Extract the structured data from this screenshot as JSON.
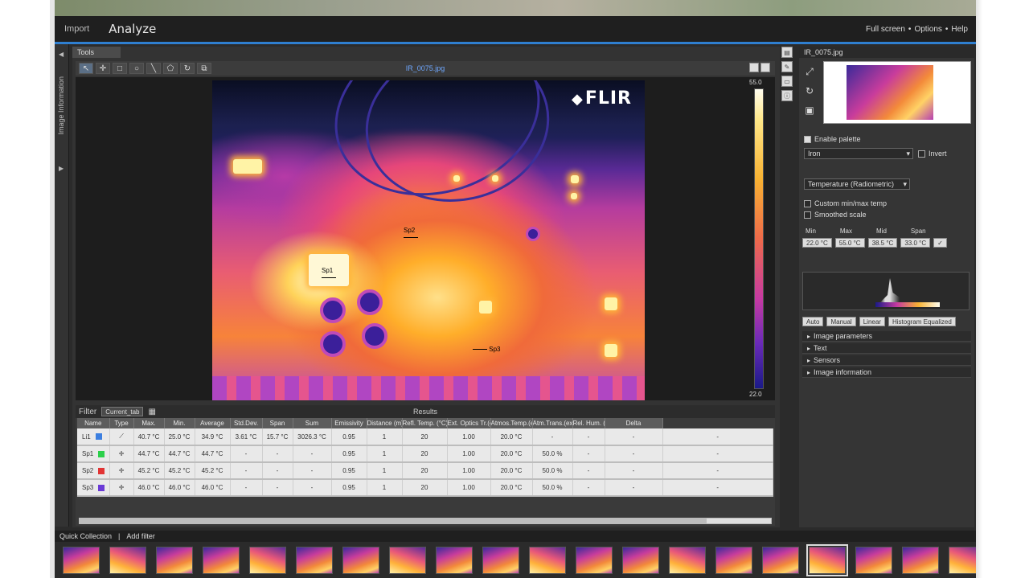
{
  "window": {
    "title": "FLIR ResearchIR"
  },
  "menu": {
    "items": [
      "Import",
      "Analyze"
    ],
    "right": [
      "Full screen",
      "Options",
      "Help"
    ]
  },
  "document": {
    "tab": "Tools",
    "filename": "IR_0075.jpg",
    "left_panel": "Image Information"
  },
  "scale": {
    "max": "55.0",
    "min": "22.0"
  },
  "thermal": {
    "logo": "FLIR",
    "markers": [
      "Sp1",
      "Sp2",
      "Sp3"
    ]
  },
  "results": {
    "filter_label": "Filter",
    "filter_value": "Current_tab",
    "title": "Results",
    "columns": [
      "Name",
      "Type",
      "Max.",
      "Min.",
      "Average",
      "Std.Dev.",
      "Span",
      "Sum",
      "Emissivity",
      "Distance (m)",
      "Refl. Temp. (°C)",
      "Ext. Optics Tr.(ex)",
      "Atmos.Temp.(ex)",
      "Atm.Trans.(ex)",
      "Rel. Hum. (%)",
      "Delta"
    ],
    "rows": [
      {
        "name": "Li1",
        "color": "#3c7fe0",
        "type": "line",
        "cells": [
          "40.7 °C",
          "25.0 °C",
          "34.9 °C",
          "3.61 °C",
          "15.7 °C",
          "3026.3 °C",
          "0.95",
          "1",
          "20",
          "1.00",
          "20.0 °C",
          "-",
          "-",
          "-",
          "-"
        ]
      },
      {
        "name": "Sp1",
        "color": "#2bd04a",
        "type": "spot",
        "cells": [
          "44.7 °C",
          "44.7 °C",
          "44.7 °C",
          "-",
          "-",
          "-",
          "0.95",
          "1",
          "20",
          "1.00",
          "20.0 °C",
          "50.0 %",
          "-",
          "-",
          "-"
        ]
      },
      {
        "name": "Sp2",
        "color": "#e23434",
        "type": "spot",
        "cells": [
          "45.2 °C",
          "45.2 °C",
          "45.2 °C",
          "-",
          "-",
          "-",
          "0.95",
          "1",
          "20",
          "1.00",
          "20.0 °C",
          "50.0 %",
          "-",
          "-",
          "-"
        ]
      },
      {
        "name": "Sp3",
        "color": "#6a3ad6",
        "type": "spot",
        "cells": [
          "46.0 °C",
          "46.0 °C",
          "46.0 °C",
          "-",
          "-",
          "-",
          "0.95",
          "1",
          "20",
          "1.00",
          "20.0 °C",
          "50.0 %",
          "-",
          "-",
          "-"
        ]
      }
    ]
  },
  "side": {
    "title": "IR_0075.jpg",
    "enable_palette": "Enable palette",
    "palette": "Iron",
    "invert": "Invert",
    "mode": "Temperature (Radiometric)",
    "check1": "Custom min/max temp",
    "check2": "Smoothed scale",
    "levels": [
      "Min",
      "Max",
      "Mid",
      "Span"
    ],
    "level_vals": [
      "22.0 °C",
      "55.0 °C",
      "38.5 °C",
      "33.0 °C"
    ],
    "hist_buttons": [
      "Auto",
      "Manual",
      "Linear",
      "Histogram Equalized"
    ],
    "accordion": [
      "Image parameters",
      "Text",
      "Sensors",
      "Image information"
    ]
  },
  "gallery": {
    "label": "Quick Collection",
    "add": "Add filter",
    "count": 20,
    "active_index": 16
  }
}
